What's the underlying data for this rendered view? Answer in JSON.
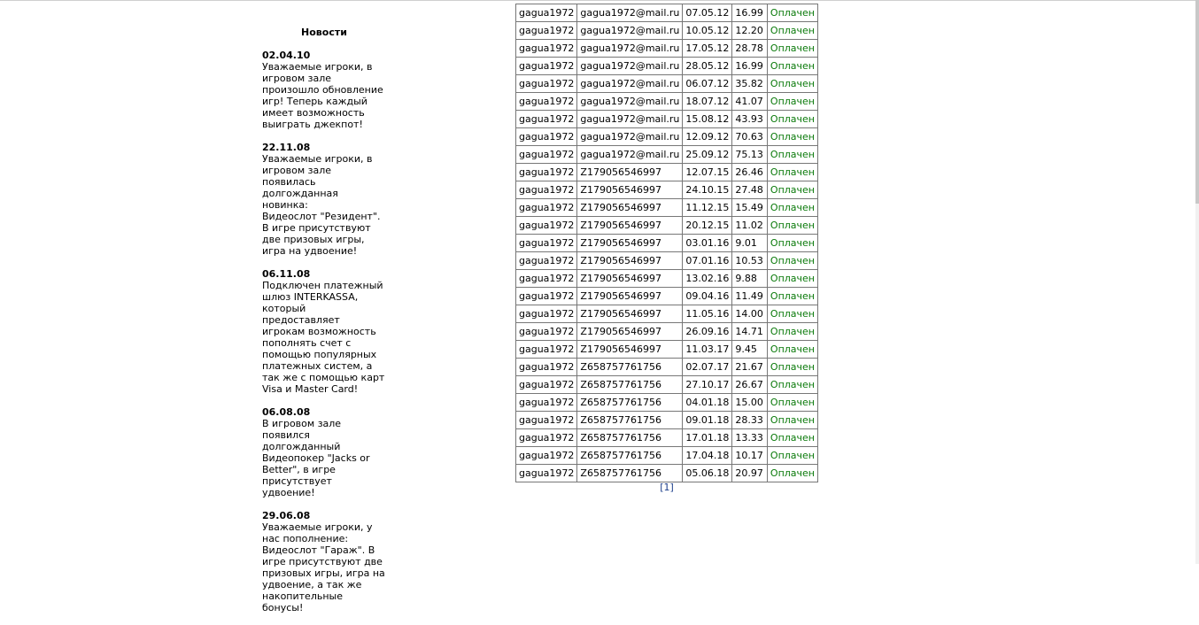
{
  "news": {
    "title": "Новости",
    "items": [
      {
        "date": "02.04.10",
        "text": "Уважаемые игроки, в\nигровом зале\nпроизошло обновление\nигр! Теперь каждый\nимеет возможность\nвыиграть джекпот!"
      },
      {
        "date": "22.11.08",
        "text": "Уважаемые игроки, в\nигровом зале\nпоявилась\nдолгожданная новинка:\nВидеослот \"Резидент\".\nВ игре присутствуют\nдве призовых игры,\nигра на удвоение!"
      },
      {
        "date": "06.11.08",
        "text": "Подключен платежный\nшлюз INTERKASSA,\nкоторый предоставляет\nигрокам возможность\nпополнять счет с\nпомощью популярных\nплатежных систем, а\nтак же с помощью карт\nVisa и Master Card!"
      },
      {
        "date": "06.08.08",
        "text": "В игровом зале\nпоявился\nдолгожданный\nВидеопокер \"Jacks or\nBetter\", в игре\nприсутствует удвоение!"
      },
      {
        "date": "29.06.08",
        "text": "Уважаемые игроки, у\nнас пополнение:\nВидеослот \"Гараж\". В\nигре присутствуют две\nпризовых игры, игра на\nудвоение, а так же\nнакопительные бонусы!"
      }
    ]
  },
  "payments": {
    "rows": [
      {
        "login": "gagua1972",
        "wallet": "gagua1972@mail.ru",
        "date": "07.05.12",
        "amount": "16.99",
        "status": "Оплачен"
      },
      {
        "login": "gagua1972",
        "wallet": "gagua1972@mail.ru",
        "date": "10.05.12",
        "amount": "12.20",
        "status": "Оплачен"
      },
      {
        "login": "gagua1972",
        "wallet": "gagua1972@mail.ru",
        "date": "17.05.12",
        "amount": "28.78",
        "status": "Оплачен"
      },
      {
        "login": "gagua1972",
        "wallet": "gagua1972@mail.ru",
        "date": "28.05.12",
        "amount": "16.99",
        "status": "Оплачен"
      },
      {
        "login": "gagua1972",
        "wallet": "gagua1972@mail.ru",
        "date": "06.07.12",
        "amount": "35.82",
        "status": "Оплачен"
      },
      {
        "login": "gagua1972",
        "wallet": "gagua1972@mail.ru",
        "date": "18.07.12",
        "amount": "41.07",
        "status": "Оплачен"
      },
      {
        "login": "gagua1972",
        "wallet": "gagua1972@mail.ru",
        "date": "15.08.12",
        "amount": "43.93",
        "status": "Оплачен"
      },
      {
        "login": "gagua1972",
        "wallet": "gagua1972@mail.ru",
        "date": "12.09.12",
        "amount": "70.63",
        "status": "Оплачен"
      },
      {
        "login": "gagua1972",
        "wallet": "gagua1972@mail.ru",
        "date": "25.09.12",
        "amount": "75.13",
        "status": "Оплачен"
      },
      {
        "login": "gagua1972",
        "wallet": "Z179056546997",
        "date": "12.07.15",
        "amount": "26.46",
        "status": "Оплачен"
      },
      {
        "login": "gagua1972",
        "wallet": "Z179056546997",
        "date": "24.10.15",
        "amount": "27.48",
        "status": "Оплачен"
      },
      {
        "login": "gagua1972",
        "wallet": "Z179056546997",
        "date": "11.12.15",
        "amount": "15.49",
        "status": "Оплачен"
      },
      {
        "login": "gagua1972",
        "wallet": "Z179056546997",
        "date": "20.12.15",
        "amount": "11.02",
        "status": "Оплачен"
      },
      {
        "login": "gagua1972",
        "wallet": "Z179056546997",
        "date": "03.01.16",
        "amount": "9.01",
        "status": "Оплачен"
      },
      {
        "login": "gagua1972",
        "wallet": "Z179056546997",
        "date": "07.01.16",
        "amount": "10.53",
        "status": "Оплачен"
      },
      {
        "login": "gagua1972",
        "wallet": "Z179056546997",
        "date": "13.02.16",
        "amount": "9.88",
        "status": "Оплачен"
      },
      {
        "login": "gagua1972",
        "wallet": "Z179056546997",
        "date": "09.04.16",
        "amount": "11.49",
        "status": "Оплачен"
      },
      {
        "login": "gagua1972",
        "wallet": "Z179056546997",
        "date": "11.05.16",
        "amount": "14.00",
        "status": "Оплачен"
      },
      {
        "login": "gagua1972",
        "wallet": "Z179056546997",
        "date": "26.09.16",
        "amount": "14.71",
        "status": "Оплачен"
      },
      {
        "login": "gagua1972",
        "wallet": "Z179056546997",
        "date": "11.03.17",
        "amount": "9.45",
        "status": "Оплачен"
      },
      {
        "login": "gagua1972",
        "wallet": "Z658757761756",
        "date": "02.07.17",
        "amount": "21.67",
        "status": "Оплачен"
      },
      {
        "login": "gagua1972",
        "wallet": "Z658757761756",
        "date": "27.10.17",
        "amount": "26.67",
        "status": "Оплачен"
      },
      {
        "login": "gagua1972",
        "wallet": "Z658757761756",
        "date": "04.01.18",
        "amount": "15.00",
        "status": "Оплачен"
      },
      {
        "login": "gagua1972",
        "wallet": "Z658757761756",
        "date": "09.01.18",
        "amount": "28.33",
        "status": "Оплачен"
      },
      {
        "login": "gagua1972",
        "wallet": "Z658757761756",
        "date": "17.01.18",
        "amount": "13.33",
        "status": "Оплачен"
      },
      {
        "login": "gagua1972",
        "wallet": "Z658757761756",
        "date": "17.04.18",
        "amount": "10.17",
        "status": "Оплачен"
      },
      {
        "login": "gagua1972",
        "wallet": "Z658757761756",
        "date": "05.06.18",
        "amount": "20.97",
        "status": "Оплачен"
      }
    ]
  },
  "pager": {
    "label": "[1]"
  },
  "colors": {
    "status_paid": "#0a7a0a",
    "link": "#1a3c8a",
    "border": "#777777"
  }
}
